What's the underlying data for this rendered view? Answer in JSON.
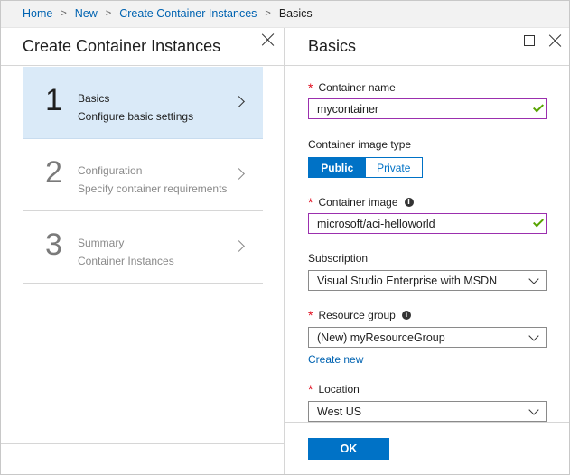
{
  "breadcrumb": {
    "items": [
      "Home",
      "New",
      "Create Container Instances"
    ],
    "current": "Basics"
  },
  "left_blade": {
    "title": "Create Container Instances",
    "steps": [
      {
        "number": "1",
        "title": "Basics",
        "subtitle": "Configure basic settings",
        "state": "active"
      },
      {
        "number": "2",
        "title": "Configuration",
        "subtitle": "Specify container requirements",
        "state": "inactive"
      },
      {
        "number": "3",
        "title": "Summary",
        "subtitle": "Container Instances",
        "state": "inactive"
      }
    ]
  },
  "right_blade": {
    "title": "Basics",
    "form": {
      "container_name": {
        "label": "Container name",
        "value": "mycontainer"
      },
      "image_type": {
        "label": "Container image type",
        "options": [
          "Public",
          "Private"
        ],
        "selected": "Public"
      },
      "container_image": {
        "label": "Container image",
        "value": "microsoft/aci-helloworld"
      },
      "subscription": {
        "label": "Subscription",
        "value": "Visual Studio Enterprise with MSDN"
      },
      "resource_group": {
        "label": "Resource group",
        "value": "(New) myResourceGroup",
        "link": "Create new"
      },
      "location": {
        "label": "Location",
        "value": "West US"
      }
    },
    "ok_label": "OK"
  },
  "icons": {
    "close": "close-icon",
    "maximize": "maximize-icon",
    "info": "info-icon",
    "chevron_right": "chevron-right-icon",
    "chevron_down": "chevron-down-icon",
    "valid": "checkmark-icon"
  },
  "colors": {
    "accent": "#0072c6",
    "link": "#0063b1",
    "active_step_bg": "#daeaf8",
    "required": "#e00b1c",
    "valid_check": "#57a300",
    "focused_border": "#9b2fae"
  },
  "info_glyph": "i"
}
